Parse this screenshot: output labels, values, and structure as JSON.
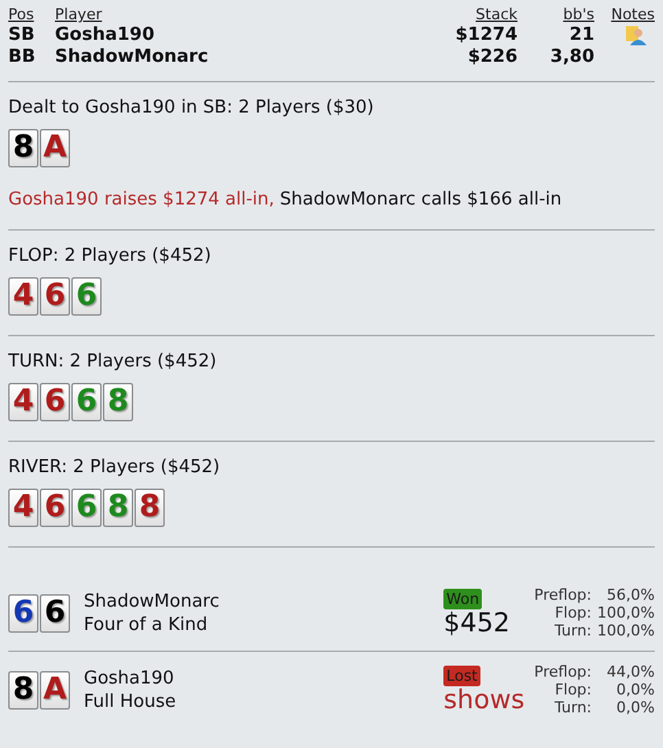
{
  "players_table": {
    "columns": [
      "Pos",
      "Player",
      "Stack",
      "bb's",
      "Notes"
    ],
    "rows": [
      {
        "pos": "SB",
        "player": "Gosha190",
        "stack": "$1274",
        "bbs": "21",
        "has_note": true
      },
      {
        "pos": "BB",
        "player": "ShadowMonarc",
        "stack": "$226",
        "bbs": "3,80",
        "has_note": false
      }
    ]
  },
  "streets": [
    {
      "title": "Dealt to Gosha190 in SB: 2 Players ($30)",
      "cards": [
        {
          "rank": "8",
          "color": "#000000"
        },
        {
          "rank": "A",
          "color": "#b01c1c"
        }
      ],
      "actions": [
        {
          "text": "Gosha190 raises $1274 all-in,",
          "hero": true
        },
        {
          "text": "ShadowMonarc calls $166 all-in",
          "hero": false
        }
      ]
    },
    {
      "title": "FLOP: 2 Players ($452)",
      "cards": [
        {
          "rank": "4",
          "color": "#b01c1c"
        },
        {
          "rank": "6",
          "color": "#b01c1c"
        },
        {
          "rank": "6",
          "color": "#1e8a1e"
        }
      ]
    },
    {
      "title": "TURN: 2 Players ($452)",
      "cards": [
        {
          "rank": "4",
          "color": "#b01c1c"
        },
        {
          "rank": "6",
          "color": "#b01c1c"
        },
        {
          "rank": "6",
          "color": "#1e8a1e"
        },
        {
          "rank": "8",
          "color": "#1e8a1e"
        }
      ]
    },
    {
      "title": "RIVER: 2 Players ($452)",
      "cards": [
        {
          "rank": "4",
          "color": "#b01c1c"
        },
        {
          "rank": "6",
          "color": "#b01c1c"
        },
        {
          "rank": "6",
          "color": "#1e8a1e"
        },
        {
          "rank": "8",
          "color": "#1e8a1e"
        },
        {
          "rank": "8",
          "color": "#b01c1c"
        }
      ]
    }
  ],
  "results": [
    {
      "cards": [
        {
          "rank": "6",
          "color": "#1438b4"
        },
        {
          "rank": "6",
          "color": "#000000"
        }
      ],
      "player": "ShadowMonarc",
      "hand": "Four of a Kind",
      "won": true,
      "badge": "Won",
      "amount": "$452",
      "equity": [
        {
          "label": "Preflop:",
          "value": "56,0%"
        },
        {
          "label": "Flop:",
          "value": "100,0%"
        },
        {
          "label": "Turn:",
          "value": "100,0%"
        }
      ]
    },
    {
      "cards": [
        {
          "rank": "8",
          "color": "#000000"
        },
        {
          "rank": "A",
          "color": "#b01c1c"
        }
      ],
      "player": "Gosha190",
      "hand": "Full House",
      "won": false,
      "badge": "Lost",
      "amount": "shows",
      "equity": [
        {
          "label": "Preflop:",
          "value": "44,0%"
        },
        {
          "label": "Flop:",
          "value": "0,0%"
        },
        {
          "label": "Turn:",
          "value": "0,0%"
        }
      ]
    }
  ]
}
